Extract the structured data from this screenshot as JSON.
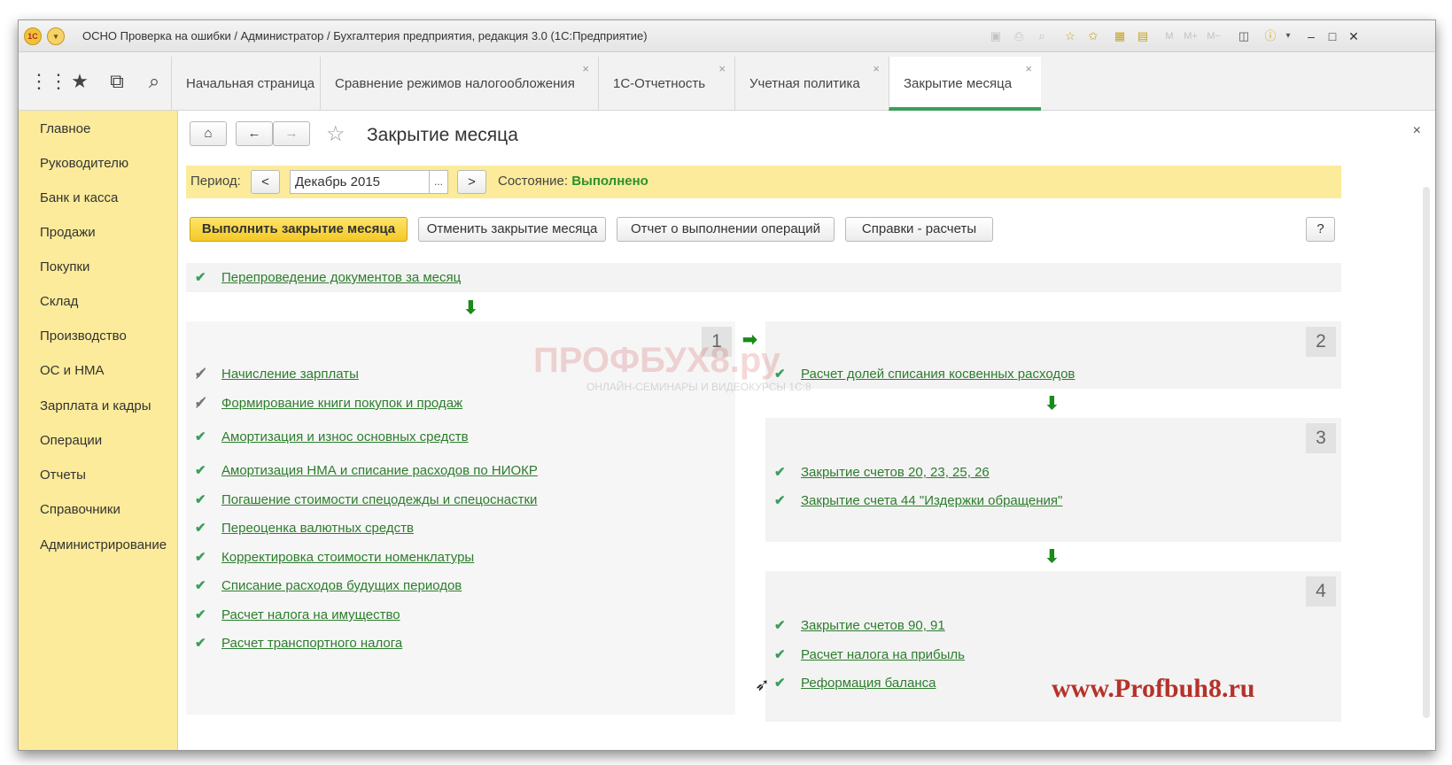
{
  "window": {
    "title": "ОСНО Проверка на ошибки / Администратор / Бухгалтерия предприятия, редакция 3.0  (1С:Предприятие)",
    "logo_text": "1С",
    "window_buttons": [
      "–",
      "□",
      "✕"
    ],
    "memory_buttons": [
      "M",
      "M+",
      "M−"
    ]
  },
  "tabs": [
    {
      "label": "Начальная страница"
    },
    {
      "label": "Сравнение режимов налогообложения",
      "close": "×"
    },
    {
      "label": "1С-Отчетность",
      "close": "×"
    },
    {
      "label": "Учетная политика",
      "close": "×"
    },
    {
      "label": "Закрытие месяца",
      "close": "×",
      "active": true
    }
  ],
  "sidebar": {
    "items": [
      "Главное",
      "Руководителю",
      "Банк и касса",
      "Продажи",
      "Покупки",
      "Склад",
      "Производство",
      "ОС и НМА",
      "Зарплата и кадры",
      "Операции",
      "Отчеты",
      "Справочники",
      "Администрирование"
    ]
  },
  "form": {
    "title": "Закрытие месяца",
    "close": "×",
    "period_label": "Период:",
    "period_value": "Декабрь 2015",
    "prev": "<",
    "next": ">",
    "dots": "...",
    "status_label": "Состояние:",
    "status_value": "Выполнено",
    "buttons": {
      "execute": "Выполнить закрытие месяца",
      "cancel": "Отменить закрытие месяца",
      "report": "Отчет о выполнении операций",
      "references": "Справки - расчеты",
      "help": "?"
    }
  },
  "operations": {
    "top": "Перепроведение документов за месяц",
    "section1": {
      "number": "1",
      "items": [
        {
          "label": "Начисление зарплаты",
          "state": "partial"
        },
        {
          "label": "Формирование книги покупок и продаж",
          "state": "partial"
        },
        {
          "label": "Амортизация и износ основных средств",
          "state": "done"
        },
        {
          "label": "Амортизация НМА и списание расходов по НИОКР",
          "state": "done"
        },
        {
          "label": "Погашение стоимости спецодежды и спецоснастки",
          "state": "done"
        },
        {
          "label": "Переоценка валютных средств",
          "state": "done"
        },
        {
          "label": "Корректировка стоимости номенклатуры",
          "state": "done"
        },
        {
          "label": "Списание расходов будущих периодов",
          "state": "done"
        },
        {
          "label": "Расчет налога на имущество",
          "state": "done"
        },
        {
          "label": "Расчет транспортного налога",
          "state": "done"
        }
      ]
    },
    "section2": {
      "number": "2",
      "items": [
        {
          "label": "Расчет долей списания косвенных расходов",
          "state": "done"
        }
      ]
    },
    "section3": {
      "number": "3",
      "items": [
        {
          "label": "Закрытие счетов 20, 23, 25, 26",
          "state": "done"
        },
        {
          "label": "Закрытие счета 44 \"Издержки обращения\"",
          "state": "done"
        }
      ]
    },
    "section4": {
      "number": "4",
      "items": [
        {
          "label": "Закрытие счетов 90, 91",
          "state": "done"
        },
        {
          "label": "Расчет налога на прибыль",
          "state": "done"
        },
        {
          "label": "Реформация баланса",
          "state": "done"
        }
      ]
    }
  },
  "watermark": {
    "brand": "ПРОФБУХ8.ру",
    "sub": "ОНЛАЙН-СЕМИНАРЫ И ВИДЕОКУРСЫ 1С:8",
    "site": "www.Profbuh8.ru"
  },
  "colors": {
    "accent_yellow": "#fbeb9a",
    "primary_button": "#f3c928",
    "link_green": "#2d7d2d",
    "status_green": "#2f8f2f",
    "active_tab_line": "#3c9e5a"
  }
}
